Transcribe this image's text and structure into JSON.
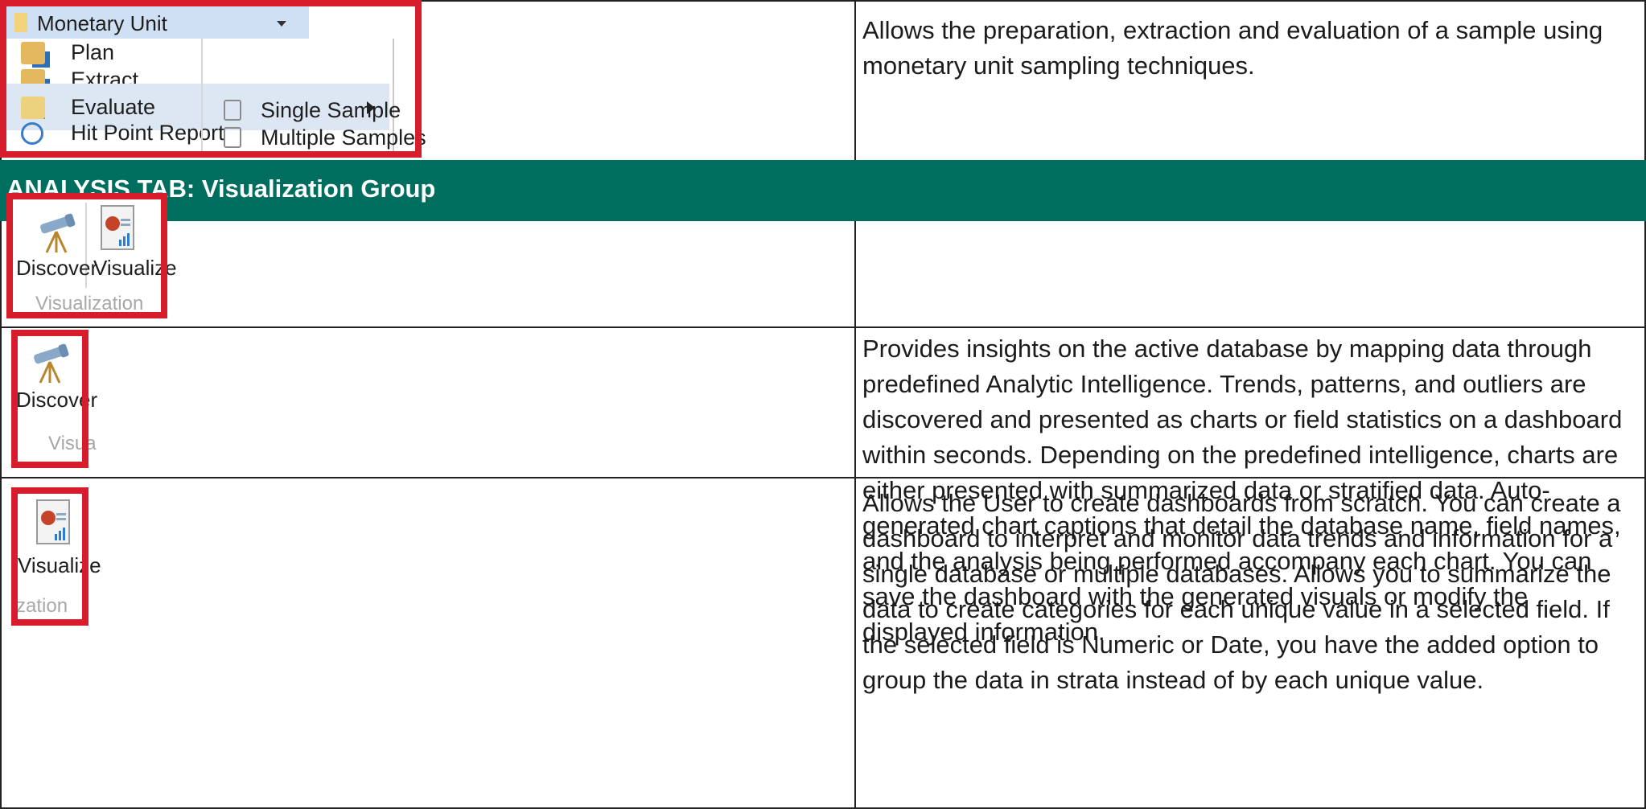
{
  "monetary_unit": {
    "button_label": "Monetary Unit",
    "items": [
      "Plan",
      "Extract",
      "Evaluate",
      "Hit Point Report"
    ],
    "submenu": [
      "Single Sample",
      "Multiple Samples"
    ],
    "description": "Allows the preparation, extraction and evaluation of a sample using monetary unit sampling techniques."
  },
  "section": {
    "title": "ANALYSIS TAB: Visualization Group"
  },
  "ribbon": {
    "discover_label": "Discover",
    "visualize_label": "Visualize",
    "group_label": "Visualization",
    "group_label_partial_1": "Visua",
    "group_label_partial_2": "zation"
  },
  "discover": {
    "description": "Provides insights on the active database by mapping data through predefined Analytic Intelligence. Trends, patterns, and outliers are discovered and presented as charts or field statistics on a dashboard within seconds. Depending on the predefined intelligence, charts are either presented with summarized data or stratified data. Auto-generated chart captions that detail the database name, field names, and the analysis being performed accompany each chart. You can save the dashboard with the generated visuals or modify the displayed information."
  },
  "visualize": {
    "description": "Allows the User to create dashboards from scratch. You can create a dashboard to interpret and monitor data trends and information for a single database or multiple databases. Allows you to summarize the data to create categories for each unique value in a selected field. If the selected field is Numeric or Date, you have the added option to group the data in strata instead of by each unique value."
  },
  "colors": {
    "header_bg": "#006e5e",
    "highlight_border": "#d71c2c"
  }
}
